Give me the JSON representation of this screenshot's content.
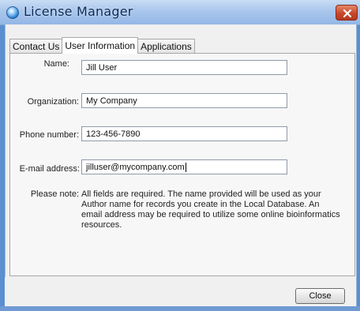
{
  "window": {
    "title": "License Manager"
  },
  "tabs": [
    {
      "label": "Contact Us",
      "active": false
    },
    {
      "label": "User Information",
      "active": true
    },
    {
      "label": "Applications",
      "active": false
    }
  ],
  "form": {
    "name": {
      "label": "Name:",
      "value": "Jill User"
    },
    "organization": {
      "label": "Organization:",
      "value": "My Company"
    },
    "phone": {
      "label": "Phone number:",
      "value": "123-456-7890"
    },
    "email": {
      "label": "E-mail address:",
      "value": "jilluser@mycompany.com"
    }
  },
  "note": {
    "label": "Please note:",
    "text": "All fields are required. The name provided will be used as your Author name for records you create in the Local Database. An email address may be required to utilize some online bioinformatics resources."
  },
  "buttons": {
    "close": "Close"
  },
  "colors": {
    "titlebar": "#a9c6ec",
    "close_button_red": "#c8472b",
    "panel_background": "#f7f7f7"
  }
}
